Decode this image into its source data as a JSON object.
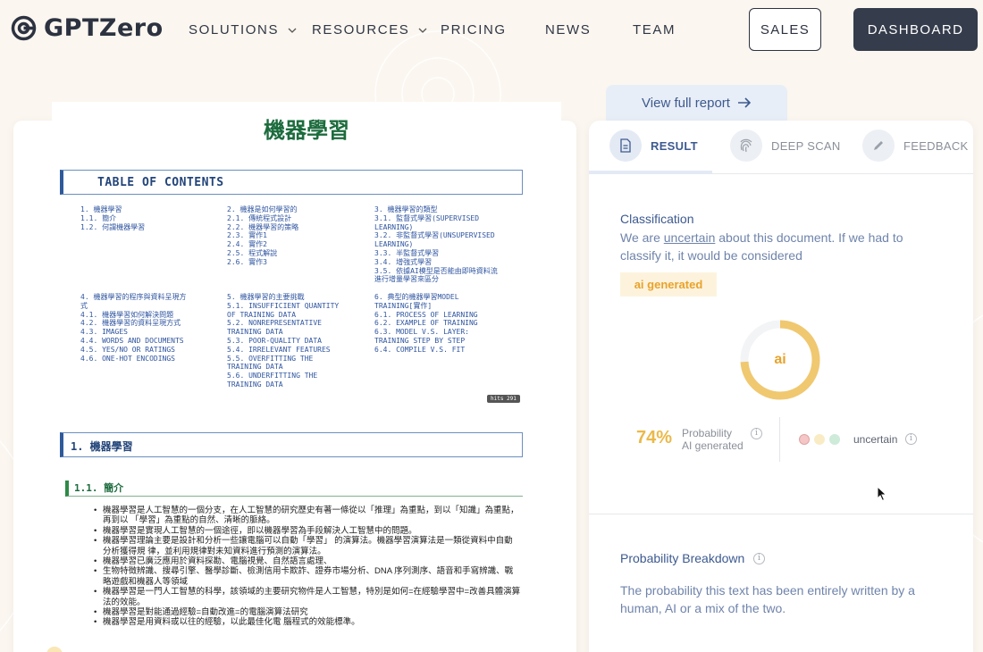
{
  "brand": {
    "name": "GPTZero"
  },
  "nav": {
    "solutions": "SOLUTIONS",
    "resources": "RESOURCES",
    "pricing": "PRICING",
    "news": "NEWS",
    "team": "TEAM",
    "sales": "SALES",
    "dashboard": "DASHBOARD"
  },
  "document": {
    "title": "機器學習",
    "toc_title": "TABLE OF CONTENTS",
    "toc_col1": [
      "1. 機器學習",
      "1.1. 簡介",
      "1.2. 何謂機器學習",
      "",
      "",
      "",
      "",
      "",
      "",
      "",
      "4. 機器學習的程序與資料呈現方",
      "式",
      "4.1. 機器學習如何解決問題",
      "4.2. 機器學習的資料呈現方式",
      "4.3. IMAGES",
      "4.4. WORDS AND DOCUMENTS",
      "4.5. YES/NO OR RATINGS",
      "4.6. ONE-HOT ENCODINGS"
    ],
    "toc_col2": [
      "2. 機器是如何學習的",
      "2.1. 傳統程式設計",
      "2.2. 機器學習的策略",
      "2.3. 實作1",
      "2.4. 實作2",
      "2.5. 程式解說",
      "2.6. 實作3",
      "",
      "",
      "",
      "5. 機器學習的主要挑戰",
      "5.1. INSUFFICIENT QUANTITY",
      "OF TRAINING DATA",
      "5.2. NONREPRESENTATIVE",
      "TRAINING DATA",
      "5.3. POOR-QUALITY DATA",
      "5.4. IRRELEVANT FEATURES",
      "5.5. OVERFITTING THE",
      "TRAINING DATA",
      "5.6. UNDERFITTING THE",
      "TRAINING DATA"
    ],
    "toc_col3": [
      "3. 機器學習的類型",
      "3.1. 監督式學習(SUPERVISED",
      "LEARNING)",
      "3.2. 非監督式學習(UNSUPERVISED",
      "LEARNING)",
      "3.3. 半監督式學習",
      "3.4. 增強式學習",
      "3.5. 依據AI模型是否能由即時資料流",
      "進行增量學習來區分",
      "",
      "6. 典型的機器學習MODEL",
      "TRAINING[實作]",
      "6.1. PROCESS OF LEARNING",
      "6.2. EXAMPLE OF TRAINING",
      "6.3. MODEL V.S. LAYER:",
      "TRAINING STEP BY STEP",
      "6.4. COMPILE V.S. FIT"
    ],
    "hits": "hits 291",
    "h1": "1. 機器學習",
    "h2": "1.1. 簡介",
    "bullets": [
      "機器學習是人工智慧的一個分支，在人工智慧的研究歷史有著一條從以「推理」為重點，到以「知識」為重點，再到以 「學習」為重點的自然、清晰的脈絡。",
      "機器學習是實現人工智慧的一個途徑，即以機器學習為手段解決人工智慧中的問題。",
      "機器學習理論主要是設計和分析一些讓電腦可以自動「學習」 的演算法。機器學習演算法是一類從資料中自動分析獲得規 律，並利用規律對未知資料進行預測的演算法。",
      "機器學習已廣泛應用於資料探勘、電腦視覺、自然語言處理、",
      "生物特徵辨識、搜尋引擎、醫學診斷、檢測信用卡欺詐、證券市場分析、DNA 序列測序、語音和手寫辨識、戰略遊戲和機器人等領域",
      "機器學習是一門人工智慧的科學，該領域的主要研究物件是人工智慧，特別是如何=在經驗學習中=改善具體演算法的效能。",
      "機器學習是對能通過經驗=自動改進=的電腦演算法研究",
      "機器學習是用資料或以往的經驗，以此最佳化電 腦程式的效能標準。"
    ]
  },
  "report": {
    "view_full": "View full report",
    "tabs": {
      "result": "RESULT",
      "deep_scan": "DEEP SCAN",
      "feedback": "FEEDBACK"
    },
    "classification_label": "Classification",
    "cls_pre": "We are ",
    "cls_word": "uncertain",
    "cls_post": " about this document. If we had to classify it, it would be considered",
    "badge": "ai generated",
    "donut_label": "ai",
    "probability_value": "74%",
    "probability_label_1": "Probability",
    "probability_label_2": "AI generated",
    "ai_probability": 0.74,
    "uncertain_label": "uncertain",
    "breakdown_label": "Probability Breakdown",
    "breakdown_text": "The probability this text has been entirely written by a human, AI or a mix of the two."
  },
  "colors": {
    "accent_orange": "#e8a32b",
    "navy": "#3d5a8f",
    "dark_button": "#353c4b",
    "dot_red": "#f4c6c6",
    "dot_yellow": "#f9ecc5",
    "dot_green": "#cdebd8"
  }
}
